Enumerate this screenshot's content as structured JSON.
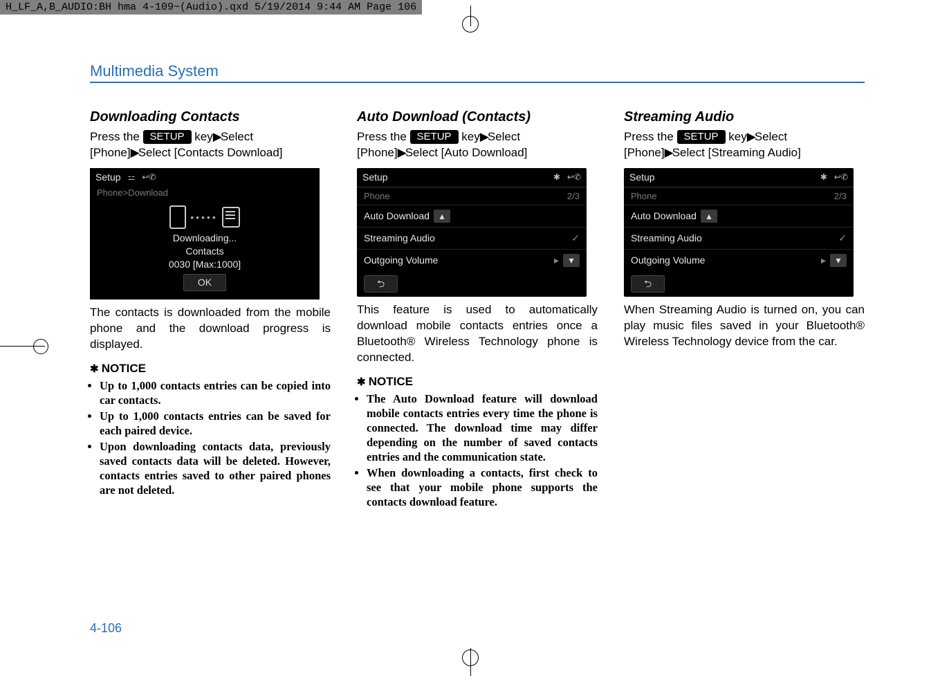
{
  "print_header": "H_LF_A,B_AUDIO:BH hma 4-109~(Audio).qxd  5/19/2014  9:44 AM  Page 106",
  "section_head": "Multimedia System",
  "page_number": "4-106",
  "key_label": "SETUP",
  "col1": {
    "h3": "Downloading Contacts",
    "lead_a": "Press  the ",
    "lead_b": " key",
    "lead_c": "Select [Phone]",
    "lead_d": "Select [Contacts Download]",
    "screen": {
      "title": "Setup",
      "crumb": "Phone>Download",
      "l1": "Downloading...",
      "l2": "Contacts",
      "l3": "0030 [Max:1000]",
      "ok": "OK"
    },
    "after": "The contacts is downloaded from the mobile phone and the download progress is displayed.",
    "notice": "NOTICE",
    "bullets": [
      "Up to 1,000 contacts entries can be copied into car contacts.",
      "Up to 1,000 contacts entries can be saved for each paired device.",
      "Upon downloading contacts data, previously saved contacts data will be deleted. However, contacts entries saved to other paired phones are not deleted."
    ]
  },
  "col2": {
    "h3": "Auto Download (Contacts)",
    "lead_a": "Press  the ",
    "lead_b": " key",
    "lead_c": "Select [Phone]",
    "lead_d": "Select [Auto Download]",
    "screen": {
      "title": "Setup",
      "sub": "Phone",
      "pg": "2/3",
      "r1": "Auto Download",
      "r2": "Streaming Audio",
      "r3": "Outgoing Volume"
    },
    "after": "This feature is used to automatically download mobile contacts entries once a Bluetooth® Wireless Technology phone is connected.",
    "notice": "NOTICE",
    "bullets": [
      "The Auto Download feature will download mobile contacts entries every time the phone is connected. The download time may differ depending on the number of saved contacts entries and the communication state.",
      "When downloading a contacts, first check to see that your mobile phone supports the contacts download feature."
    ]
  },
  "col3": {
    "h3": "Streaming Audio",
    "lead_a": "Press  the ",
    "lead_b": " key",
    "lead_c": "Select [Phone]",
    "lead_d": "Select [Streaming Audio]",
    "screen": {
      "title": "Setup",
      "sub": "Phone",
      "pg": "2/3",
      "r1": "Auto Download",
      "r2": "Streaming Audio",
      "r3": "Outgoing Volume"
    },
    "after": "When Streaming Audio is turned on, you can play music files saved in your Bluetooth® Wireless Technology device from the car."
  }
}
